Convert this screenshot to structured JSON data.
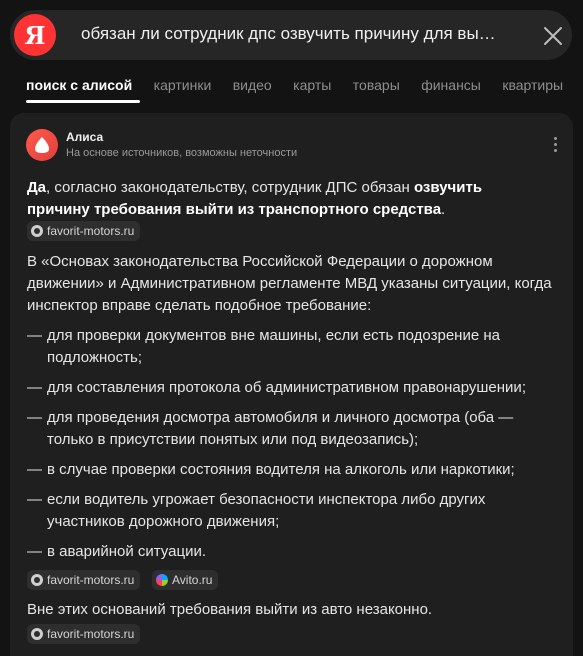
{
  "search": {
    "logo": "Я",
    "query": "обязан ли сотрудник дпс озвучить причину для вы…",
    "clear_icon": "close-icon"
  },
  "tabs": [
    {
      "label": "поиск с алисой",
      "active": true
    },
    {
      "label": "картинки"
    },
    {
      "label": "видео"
    },
    {
      "label": "карты"
    },
    {
      "label": "товары"
    },
    {
      "label": "финансы"
    },
    {
      "label": "квартиры"
    }
  ],
  "answer": {
    "author": "Алиса",
    "disclaimer": "На основе источников, возможны неточности",
    "intro_bold_1": "Да",
    "intro_text": ", согласно законодательству, сотрудник ДПС обязан ",
    "intro_bold_2": "озвучить",
    "intro_line2_bold": "причину требования выйти из транспортного средства",
    "intro_line2_end": ".",
    "source_1": "favorit-motors.ru",
    "para_1": "В «Основах законодательства Российской Федерации о дорожном движении» и Административном регламенте МВД указаны ситуации, когда инспектор вправе сделать подобное требование:",
    "list": [
      "для проверки документов вне машины, если есть подозрение на подложность;",
      "для составления протокола об административном правонарушении;",
      "для проведения досмотра автомобиля и личного досмотра (оба — только в присутствии понятых или под видеозапись);",
      "в случае проверки состояния водителя на алкоголь или наркотики;",
      "если водитель угрожает безопасности инспектора либо других участников дорожного движения;",
      "в аварийной ситуации."
    ],
    "dash": "—",
    "sources_2": [
      "favorit-motors.ru",
      "Avito.ru"
    ],
    "para_2": "Вне этих оснований требования выйти из авто незаконно.",
    "source_3": "favorit-motors.ru"
  },
  "colors": {
    "background": "#131313",
    "card": "#1f1f1f",
    "logo": "#ff3333"
  }
}
